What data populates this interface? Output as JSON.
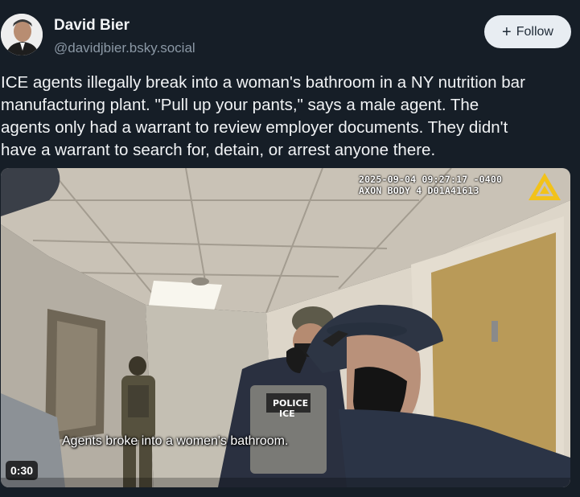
{
  "author": {
    "display_name": "David Bier",
    "handle": "@davidjbier.bsky.social"
  },
  "follow_button": {
    "label": "Follow"
  },
  "post": {
    "text_lines": [
      "ICE agents illegally break into a woman's bathroom in a NY nutrition bar",
      "manufacturing plant. \"Pull up your pants,\" says a male agent. The",
      "agents only had a warrant to review employer documents. They didn't",
      "have a warrant to search for, detain, or arrest anyone there."
    ]
  },
  "video": {
    "overlay_timestamp": "2025-09-04 09:27:17 -0400",
    "overlay_device": "AXON BODY 4 D01A41613",
    "caption": "Agents broke into a women's bathroom.",
    "duration": "0:30",
    "vest_label_police": "POLICE",
    "vest_label_ice": "ICE"
  },
  "icons": {
    "follow": "plus-icon",
    "bodycam": "axon-logo-icon"
  }
}
